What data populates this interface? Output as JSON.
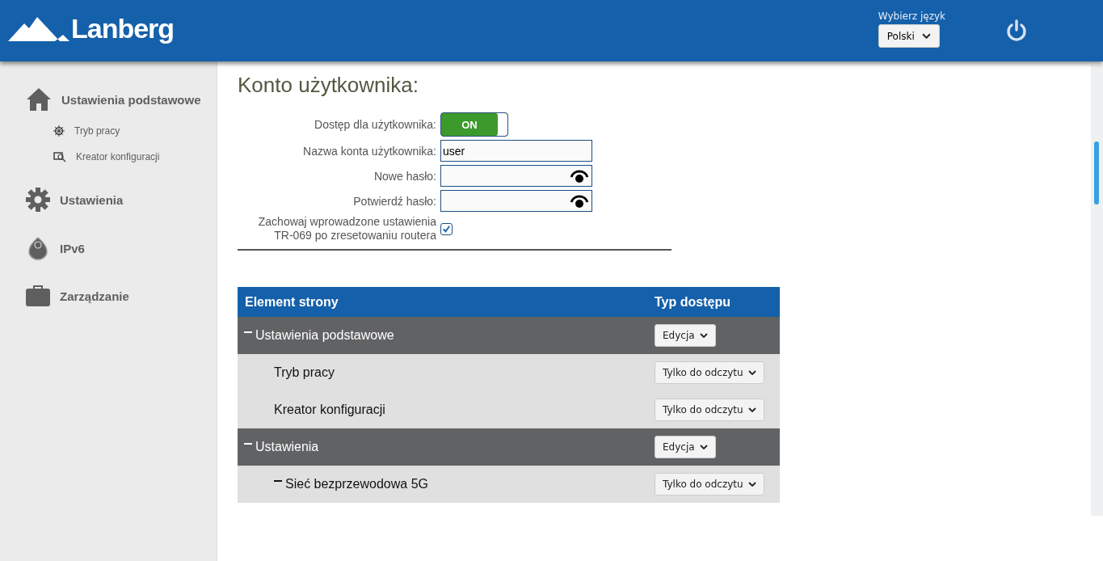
{
  "header": {
    "logo": "Lanberg",
    "language_label": "Wybierz język",
    "language": "Polski"
  },
  "sidebar": {
    "items": [
      {
        "kind": "home",
        "label": "Ustawienia podstawowe",
        "children": [
          {
            "kind": "mode",
            "label": "Tryb pracy"
          },
          {
            "kind": "wizard",
            "label": "Kreator konfiguracji"
          }
        ]
      },
      {
        "kind": "gear",
        "label": "Ustawienia"
      },
      {
        "kind": "ipv6",
        "label": "IPv6"
      },
      {
        "kind": "briefcase",
        "label": "Zarządzanie"
      }
    ]
  },
  "title": "Konto użytkownika:",
  "form": {
    "access_label": "Dostęp dla użytkownika:",
    "access_on": true,
    "access_text": "ON",
    "username_label": "Nazwa konta użytkownika:",
    "username": "user",
    "new_password_label": "Nowe hasło:",
    "confirm_password_label": "Potwierdź hasło:",
    "keep_label": "Zachowaj wprowadzone ustawienia TR-069 po zresetowaniu routera",
    "keep_checked": true
  },
  "table": {
    "columns": [
      "Element strony",
      "Typ dostępu"
    ],
    "rows": [
      {
        "label": "Ustawienia podstawowe",
        "access": "Edycja",
        "expanded": true,
        "children": [
          {
            "label": "Tryb pracy",
            "access": "Tylko do odczytu"
          },
          {
            "label": "Kreator konfiguracji",
            "access": "Tylko do odczytu"
          }
        ]
      },
      {
        "label": "Ustawienia",
        "access": "Edycja",
        "expanded": true,
        "children": [
          {
            "label": "Sieć bezprzewodowa 5G",
            "access": "Tylko do odczytu",
            "expanded": true
          }
        ]
      }
    ]
  }
}
